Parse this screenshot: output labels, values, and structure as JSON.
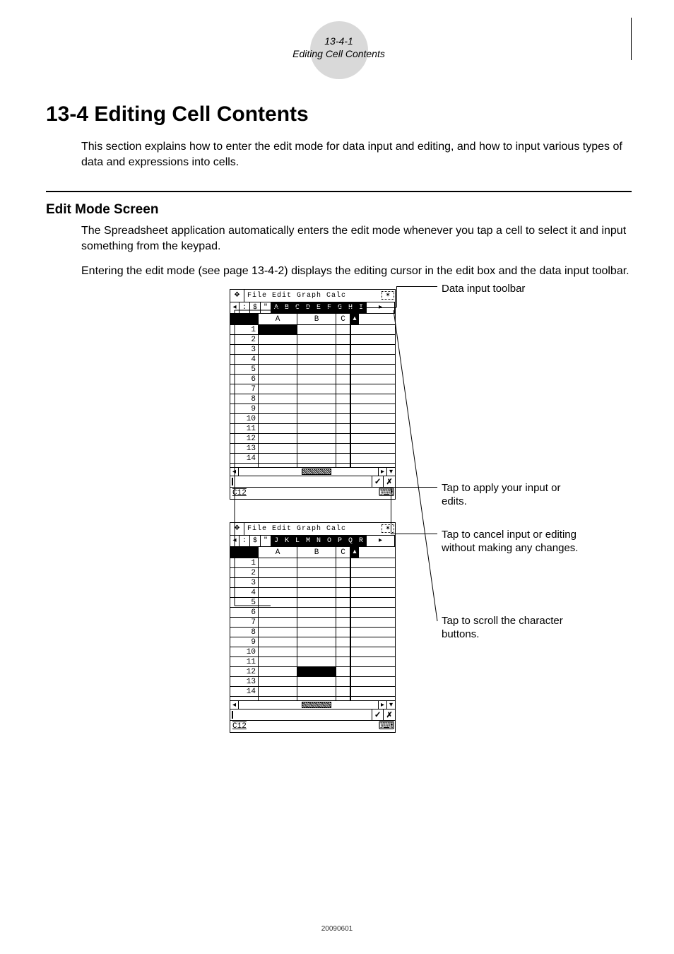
{
  "header": {
    "num": "13-4-1",
    "title": "Editing Cell Contents"
  },
  "h1": "13-4  Editing Cell Contents",
  "intro": "This section explains how to enter the edit mode for data input and editing, and how to input various types of data and expressions into cells.",
  "h2": "Edit Mode Screen",
  "body1": "The Spreadsheet application automatically enters the edit mode whenever you tap a cell to select it and input something from the keypad.",
  "body2": "Entering the edit mode (see page 13-4-2) displays the editing cursor in the edit box and the data input toolbar.",
  "annotations": {
    "toolbar_label": "Data input toolbar",
    "apply": "Tap to apply your input or edits.",
    "cancel": "Tap to cancel input or editing without making any changes.",
    "scroll": "Tap to scroll the character buttons."
  },
  "screenshot1": {
    "menu": "File Edit Graph Calc",
    "toolbar_scroll_left": "◂",
    "toolbar_fixed": [
      ":",
      "$",
      "\""
    ],
    "toolbar_chars": [
      "A",
      "B",
      "C",
      "D",
      "E",
      "F",
      "G",
      "H",
      "I"
    ],
    "toolbar_scroll_right": "▸",
    "columns": [
      "A",
      "B",
      "C"
    ],
    "rows": [
      "1",
      "2",
      "3",
      "4",
      "5",
      "6",
      "7",
      "8",
      "9",
      "10",
      "11",
      "12",
      "13",
      "14"
    ],
    "selected": "A1",
    "ok": "✓",
    "cancel": "✗",
    "cellref": "C12"
  },
  "screenshot2": {
    "menu": "File Edit Graph Calc",
    "toolbar_scroll_left": "◂",
    "toolbar_fixed": [
      ":",
      "$",
      "\""
    ],
    "toolbar_chars": [
      "J",
      "K",
      "L",
      "M",
      "N",
      "O",
      "P",
      "Q",
      "R"
    ],
    "toolbar_scroll_right": "▸",
    "columns": [
      "A",
      "B",
      "C"
    ],
    "rows": [
      "1",
      "2",
      "3",
      "4",
      "5",
      "6",
      "7",
      "8",
      "9",
      "10",
      "11",
      "12",
      "13",
      "14"
    ],
    "selected": "B12",
    "ok": "✓",
    "cancel": "✗",
    "cellref": "C12"
  },
  "footer": "20090601"
}
